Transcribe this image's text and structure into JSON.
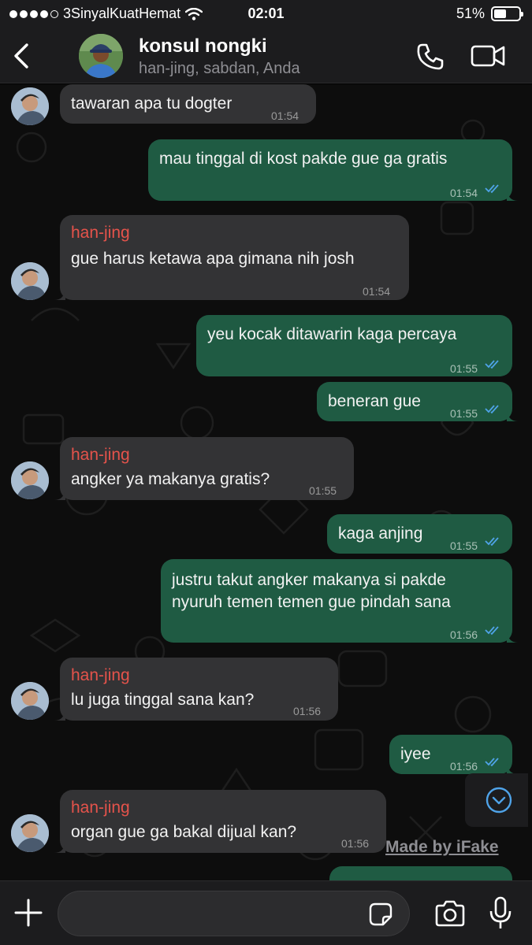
{
  "status_bar": {
    "carrier": "3SinyalKuatHemat",
    "time": "02:01",
    "battery_text": "51%",
    "battery_level": 0.51
  },
  "header": {
    "title": "konsul nongki",
    "subtitle": "han-jing, sabdan, Anda"
  },
  "messages": [
    {
      "dir": "in",
      "sender": "",
      "text": [
        "tawaran apa tu dogter"
      ],
      "time": "01:54"
    },
    {
      "dir": "out",
      "text": [
        "mau tinggal di kost pakde gue ga gratis"
      ],
      "time": "01:54"
    },
    {
      "dir": "in",
      "sender": "han-jing",
      "text": [
        "gue harus ketawa apa gimana nih josh"
      ],
      "time": "01:54"
    },
    {
      "dir": "out",
      "text": [
        "yeu kocak ditawarin kaga percaya"
      ],
      "time": "01:55"
    },
    {
      "dir": "out",
      "text": [
        "beneran gue"
      ],
      "time": "01:55"
    },
    {
      "dir": "in",
      "sender": "han-jing",
      "text": [
        "angker ya makanya gratis?"
      ],
      "time": "01:55"
    },
    {
      "dir": "out",
      "text": [
        "kaga anjing"
      ],
      "time": "01:55"
    },
    {
      "dir": "out",
      "text": [
        "justru takut angker makanya si pakde",
        "nyuruh temen temen gue pindah sana"
      ],
      "time": "01:56"
    },
    {
      "dir": "in",
      "sender": "han-jing",
      "text": [
        "lu juga tinggal sana kan?"
      ],
      "time": "01:56"
    },
    {
      "dir": "out",
      "text": [
        "iyee"
      ],
      "time": "01:56"
    },
    {
      "dir": "in",
      "sender": "han-jing",
      "text": [
        "organ gue ga bakal dijual kan?"
      ],
      "time": "01:56"
    }
  ],
  "watermark": "Made by iFake",
  "input": {
    "placeholder": "",
    "value": ""
  },
  "icons": {
    "back": "chevron-left-icon",
    "call": "phone-icon",
    "video": "video-camera-icon",
    "scroll": "chevron-down-circle-icon",
    "plus": "plus-icon",
    "sticker": "sticker-icon",
    "camera": "camera-icon",
    "mic": "microphone-icon"
  },
  "colors": {
    "incoming_bubble": "#333335",
    "outgoing_bubble": "#1f5b43",
    "sender_name": "#e5534b",
    "read_ticks": "#4fa3e8",
    "bar_background": "#1c1c1e"
  }
}
